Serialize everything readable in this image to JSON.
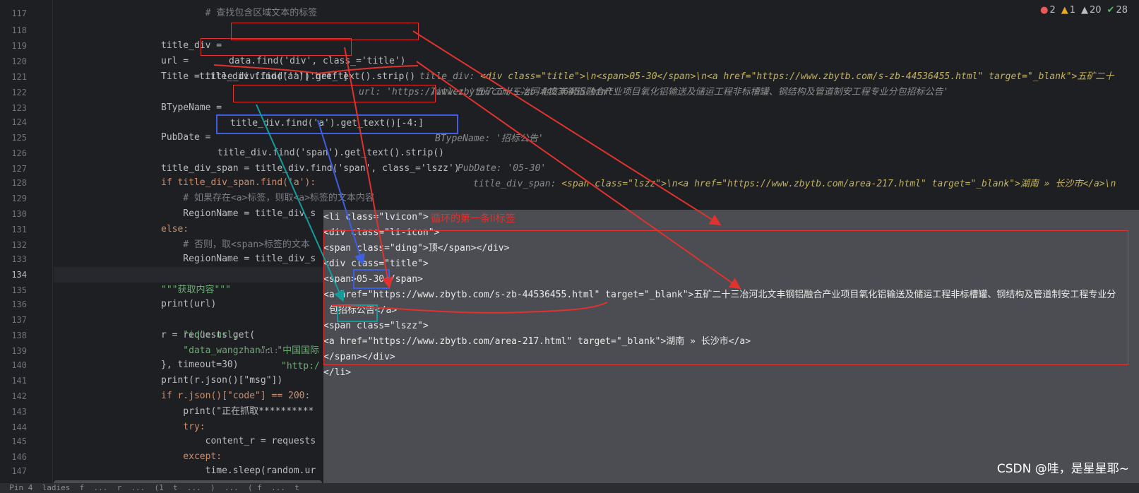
{
  "badges": {
    "errors": "2",
    "warnings": "1",
    "weak_warnings": "20",
    "ok": "28"
  },
  "line_numbers": [
    "117",
    "118",
    "119",
    "120",
    "121",
    "122",
    "123",
    "124",
    "125",
    "126",
    "127",
    "128",
    "129",
    "130",
    "131",
    "132",
    "133",
    "134",
    "135",
    "136",
    "137",
    "138",
    "139",
    "140",
    "141",
    "142",
    "143",
    "144",
    "145",
    "146",
    "147"
  ],
  "code": {
    "l116": "        # 查找包含区域文本的标签",
    "l118_a": "title_div = ",
    "l118_b": "data.find('div', class_='title')",
    "l119_a": "url = ",
    "l119_b": "title_div.find('a')['href']",
    "l120": "Title = title_div.find('a').get_text().strip()",
    "l122_a": "BTypeName = ",
    "l122_b": "title_div.find('a').get_text()[-4:]",
    "l124_a": "PubDate = ",
    "l124_b": "title_div.find('span').get_text().strip()",
    "l126": "title_div_span = title_div.find('span', class_='lszz')",
    "l128": "if title_div_span.find('a'):",
    "l129": "    # 如果存在<a>标签，则取<a>标签的文本内容",
    "l130": "    RegionName = title_div_s",
    "l131": "else:",
    "l132": "    # 否则，取<span>标签的文本",
    "l133": "    RegionName = title_div_s",
    "l135": "\"\"\"获取内容\"\"\"",
    "l136": "print(url)",
    "l137_a": "r = requests.get(",
    "l137_b": "url:",
    "l137_c": "\"http:/",
    "l138": "    \"id\": url,",
    "l139": "    \"data_wangzhan\": \"中国国际",
    "l140": "}, timeout=30)",
    "l141": "print(r.json()[\"msg\"])",
    "l142": "if r.json()[\"code\"] == 200:",
    "l143": "    print(\"正在抓取**********",
    "l144": "    try:",
    "l145": "        content_r = requests",
    "l146": "    except:",
    "l147": "        time.sleep(random.ur"
  },
  "hints": {
    "h118_k": "title_div: ",
    "h118_v": "<div class=\"title\">\\n<span>05-30</span>\\n<a href=\"https://www.zbytb.com/s-zb-44536455.html\" target=\"_blank\">五矿二十",
    "h119": "url: 'https://www.zbytb.com/s-zb-44536455.html'",
    "h120": "Title: '五矿二十三冶河北文丰钢铝融合产业项目氧化铝输送及储运工程非标槽罐、钢结构及管道制安工程专业分包招标公告'",
    "h122": "BTypeName: '招标公告'",
    "h124": "PubDate: '05-30'",
    "h126_k": "title_div_span: ",
    "h126_v": "<span class=\"lszz\">\\n<a href=\"https://www.zbytb.com/area-217.html\" target=\"_blank\">湖南 » 长沙市</a>\\n"
  },
  "popup": {
    "label": "循环的第一条li标签",
    "lines": [
      "<li class=\"lvicon\">",
      "<div class=\"li-icon\">",
      "<span class=\"ding\">顶</span></div>",
      "<div class=\"title\">",
      "<span>05-30</span>",
      "<a href=\"https://www.zbytb.com/s-zb-44536455.html\" target=\"_blank\">五矿二十三冶河北文丰钢铝融合产业项目氧化铝输送及储运工程非标槽罐、钢结构及管道制安工程专业分",
      " 包招标公告</a>",
      "<span class=\"lszz\">",
      "<a href=\"https://www.zbytb.com/area-217.html\" target=\"_blank\">湖南 » 长沙市</a>",
      "</span></div>",
      "</li>"
    ]
  },
  "watermark": "CSDN @哇，是星星耶~",
  "status_text": "  Pin 4  ladies  f  ...  r  ...  (1  t  ...  )  ...  ( f  ...  t"
}
